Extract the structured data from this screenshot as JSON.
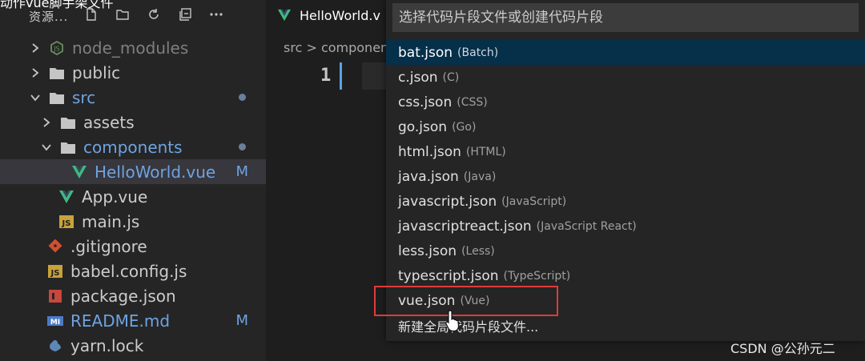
{
  "overlay_caption": "动作vue脚手架文件",
  "explorer": {
    "title": "资源...",
    "actions": [
      "new-file-icon",
      "new-folder-icon",
      "refresh-icon",
      "collapse-all-icon",
      "more-icon"
    ],
    "items": [
      {
        "label": "node_modules",
        "kind": "folder",
        "icon": "node-icon",
        "expanded": false,
        "dim": true
      },
      {
        "label": "public",
        "kind": "folder",
        "icon": "folder-icon",
        "expanded": false
      },
      {
        "label": "src",
        "kind": "folder",
        "icon": "folder-icon",
        "expanded": true,
        "modified": true
      },
      {
        "label": "assets",
        "kind": "folder",
        "icon": "folder-icon",
        "expanded": false
      },
      {
        "label": "components",
        "kind": "folder",
        "icon": "folder-icon",
        "expanded": true,
        "modified": true
      },
      {
        "label": "HelloWorld.vue",
        "kind": "file",
        "icon": "vue-icon",
        "badge": "M",
        "selected": true
      },
      {
        "label": "App.vue",
        "kind": "file",
        "icon": "vue-icon"
      },
      {
        "label": "main.js",
        "kind": "file",
        "icon": "js-icon",
        "icon_text": "JS"
      },
      {
        "label": ".gitignore",
        "kind": "file",
        "icon": "git-icon"
      },
      {
        "label": "babel.config.js",
        "kind": "file",
        "icon": "js-icon",
        "icon_text": "JS"
      },
      {
        "label": "package.json",
        "kind": "file",
        "icon": "npm-icon"
      },
      {
        "label": "README.md",
        "kind": "file",
        "icon": "markdown-icon",
        "icon_text": "MI",
        "badge": "M"
      },
      {
        "label": "yarn.lock",
        "kind": "file",
        "icon": "yarn-icon"
      }
    ]
  },
  "editor": {
    "tab_label": "HelloWorld.v",
    "breadcrumb": "src > componen",
    "line_number": "1"
  },
  "quickpick": {
    "placeholder": "选择代码片段文件或创建代码片段",
    "items": [
      {
        "name": "bat.json",
        "desc": "(Batch)",
        "active": true
      },
      {
        "name": "c.json",
        "desc": "(C)"
      },
      {
        "name": "css.json",
        "desc": "(CSS)"
      },
      {
        "name": "go.json",
        "desc": "(Go)"
      },
      {
        "name": "html.json",
        "desc": "(HTML)"
      },
      {
        "name": "java.json",
        "desc": "(Java)"
      },
      {
        "name": "javascript.json",
        "desc": "(JavaScript)"
      },
      {
        "name": "javascriptreact.json",
        "desc": "(JavaScript React)"
      },
      {
        "name": "less.json",
        "desc": "(Less)"
      },
      {
        "name": "typescript.json",
        "desc": "(TypeScript)"
      },
      {
        "name": "vue.json",
        "desc": "(Vue)"
      }
    ],
    "new_global": "新建全局代码片段文件..."
  },
  "watermark": "CSDN @公孙元二",
  "colors": {
    "accent": "#062f4a",
    "highlight": "#e03a3a",
    "vue_green": "#41b883",
    "modified": "#6fa3e0"
  }
}
